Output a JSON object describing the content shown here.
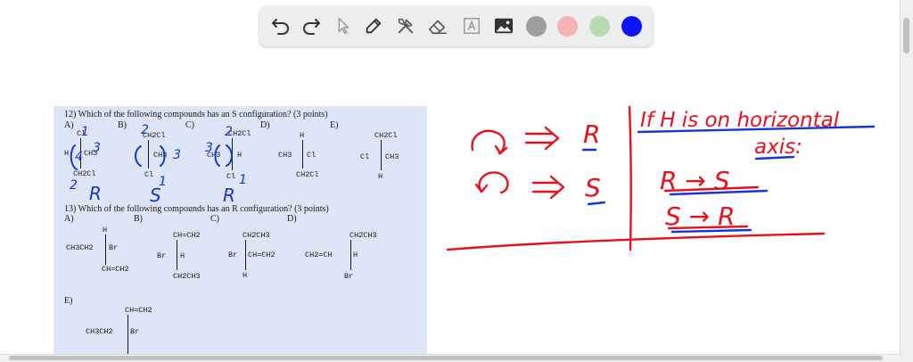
{
  "toolbar": {
    "tools": [
      "undo-icon",
      "redo-icon",
      "select-icon",
      "pen-icon",
      "tools-icon",
      "eraser-icon",
      "text-icon",
      "image-icon"
    ],
    "colors": [
      "#9e9e9e",
      "#f4b4b4",
      "#b7dcb0",
      "#0a14ff"
    ]
  },
  "sheet": {
    "q12": {
      "text": "12) Which of the following compounds has an S configuration? (3 points)",
      "options": [
        "A)",
        "B)",
        "C)",
        "D)",
        "E)"
      ],
      "a": {
        "top": "Cl",
        "left": "H",
        "right": "CH3",
        "bottom": "CH2Cl"
      },
      "b": {
        "top": "CH2Cl",
        "right": "CH3",
        "bottom": "Cl"
      },
      "c": {
        "top": "CH2Cl",
        "left": "CH3",
        "right": "H",
        "bottom": "Cl"
      },
      "d": {
        "top": "H",
        "left": "CH3",
        "right": "Cl",
        "bottom": "CH2Cl"
      },
      "e": {
        "top": "CH2Cl",
        "left": "Cl",
        "right": "CH3",
        "bottom": "H"
      }
    },
    "q13": {
      "text": "13) Which of the following compounds has an R configuration? (3 points)",
      "options": [
        "A)",
        "B)",
        "C)",
        "D)",
        "E)"
      ],
      "a": {
        "top": "H",
        "left": "CH3CH2",
        "right": "Br",
        "bottom": "CH=CH2"
      },
      "b": {
        "top": "CH=CH2",
        "left": "Br",
        "right": "H",
        "bottom": "CH2CH3"
      },
      "c": {
        "top": "CH2CH3",
        "left": "Br",
        "right": "CH=CH2",
        "bottom": "H"
      },
      "d": {
        "top": "CH2CH3",
        "left": "CH2=CH",
        "right": "H",
        "bottom": "Br"
      },
      "e": {
        "top": "CH=CH2",
        "left": "CH3CH2",
        "right": "Br"
      }
    }
  },
  "handwriting": {
    "rule_r": "R",
    "rule_s": "S",
    "note_title_1": "If H is on horizontal",
    "note_title_2": "axis:",
    "swap_1": "R → S",
    "swap_2": "S → R",
    "annot_a_1": "1",
    "annot_a_3": "3",
    "annot_a_4": "4",
    "annot_a_2": "2",
    "annot_a_letter": "R",
    "annot_b_2": "2",
    "annot_b_3": "3",
    "annot_b_1": "1",
    "annot_b_letter": "S",
    "annot_c_2": "2",
    "annot_c_3": "3",
    "annot_c_1": "1",
    "annot_c_letter": "R",
    "ink_colors": {
      "red": "#e8101c",
      "blue": "#1236d8"
    }
  }
}
